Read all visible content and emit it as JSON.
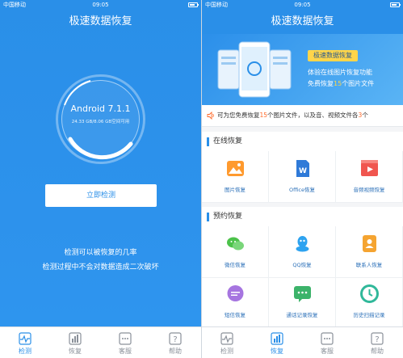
{
  "status": {
    "carrier": "中国移动",
    "time": "09:05"
  },
  "app_title": "极速数据恢复",
  "left": {
    "os_version": "Android 7.1.1",
    "storage": "24.33 GB/8.06 GB空间可用",
    "detect_button": "立即检测",
    "hint1": "检测可以被恢复的几率",
    "hint2": "检测过程中不会对数据造成二次破坏"
  },
  "tabs": [
    {
      "label": "检测",
      "icon": "pulse-icon"
    },
    {
      "label": "恢复",
      "icon": "chart-icon"
    },
    {
      "label": "客服",
      "icon": "chat-icon"
    },
    {
      "label": "帮助",
      "icon": "help-icon"
    }
  ],
  "right": {
    "banner": {
      "title": "极速数据恢复",
      "line1": "体验在线图片恢复功能",
      "line2_prefix": "免费恢复",
      "line2_num": "15",
      "line2_suffix": "个图片文件"
    },
    "notice": {
      "prefix": "可为您免费恢复",
      "num1": "15",
      "middle": "个图片文件，以及音、视频文件各",
      "num2": "3",
      "suffix": "个"
    },
    "online_title": "在线恢复",
    "online_items": [
      {
        "label": "图片恢复",
        "icon": "image-icon",
        "color": "#ff9a2e"
      },
      {
        "label": "Office恢复",
        "icon": "word-icon",
        "color": "#2f7ad8"
      },
      {
        "label": "音频视频恢复",
        "icon": "video-icon",
        "color": "#f0564f"
      }
    ],
    "booking_title": "预约恢复",
    "booking_items": [
      {
        "label": "微信恢复",
        "icon": "wechat-icon",
        "color": "#4cc24a"
      },
      {
        "label": "QQ恢复",
        "icon": "qq-icon",
        "color": "#2ea3f0"
      },
      {
        "label": "联系人恢复",
        "icon": "contacts-icon",
        "color": "#f5a431"
      },
      {
        "label": "短信恢复",
        "icon": "sms-icon",
        "color": "#a675e0"
      },
      {
        "label": "通话记录恢复",
        "icon": "call-log-icon",
        "color": "#3cb36a"
      },
      {
        "label": "历史扫描记录",
        "icon": "history-icon",
        "color": "#30b89a"
      }
    ]
  }
}
